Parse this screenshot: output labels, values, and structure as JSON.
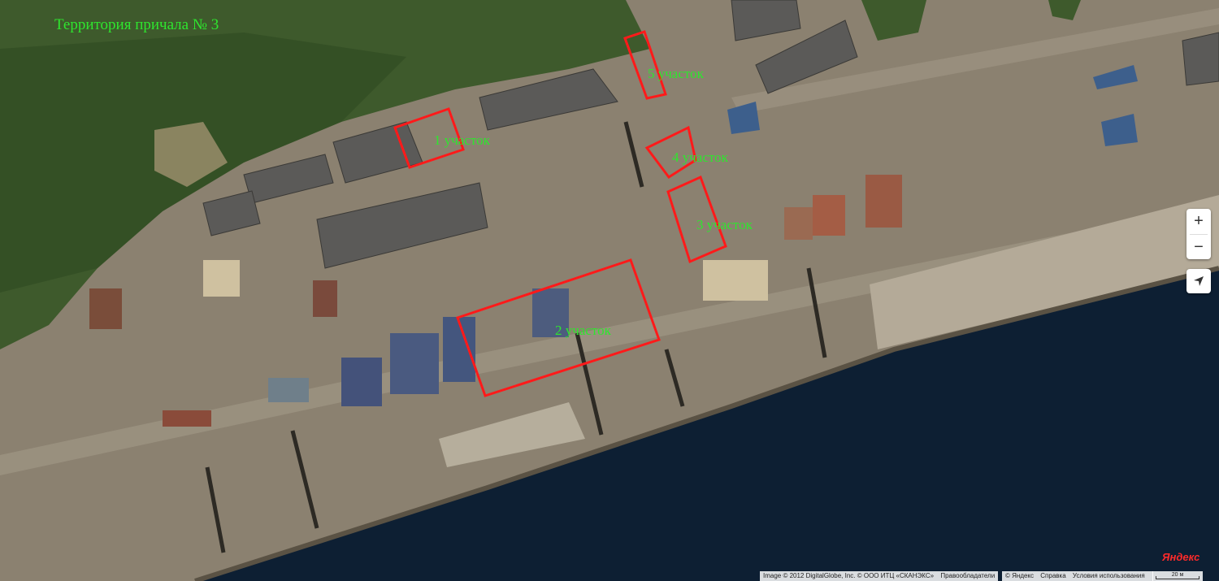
{
  "map": {
    "title": "Территория причала № 3",
    "plots": [
      {
        "label": "1 участок"
      },
      {
        "label": "2 участок"
      },
      {
        "label": "3 участок"
      },
      {
        "label": "4 участок"
      },
      {
        "label": "5 участок"
      }
    ],
    "highlight_color": "#ff1a1a",
    "label_color": "#2ee62e",
    "watermark": "Yandex"
  },
  "controls": {
    "zoom_in": "+",
    "zoom_out": "−",
    "locate_icon": "navigation-arrow-icon"
  },
  "attribution": {
    "copyright": "Image © 2012 DigitalGlobe, Inc. © ООО ИТЦ «СКАНЭКС»",
    "rights_link": "Правообладатели",
    "yandex_copyright": "© Яндекс",
    "help_link": "Справка",
    "terms_link": "Условия использования",
    "scale_label": "20 м",
    "logo_text": "Яндекс"
  }
}
